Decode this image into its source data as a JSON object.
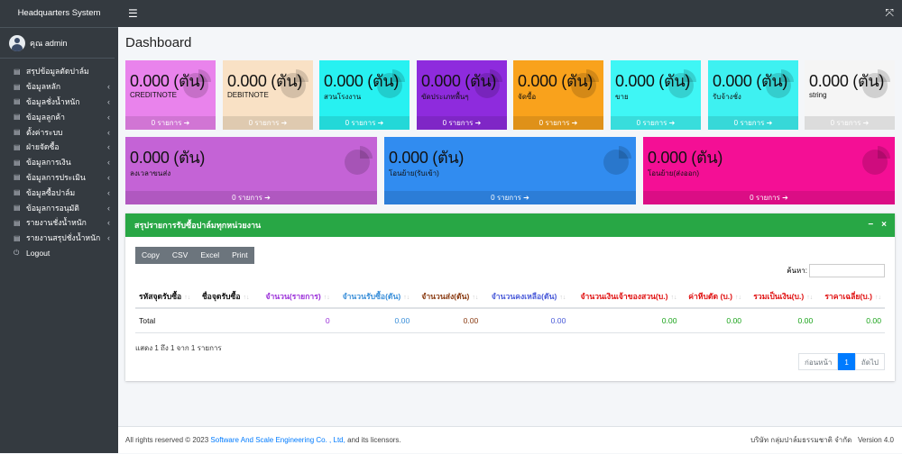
{
  "sidebar": {
    "brand": "Headquarters System",
    "user": "คุณ admin",
    "items": [
      {
        "label": "สรุปข้อมูลตัดปาล์ม",
        "chevron": ""
      },
      {
        "label": "ข้อมูลหลัก",
        "chevron": "‹"
      },
      {
        "label": "ข้อมูลชั่งน้ำหนัก",
        "chevron": "‹"
      },
      {
        "label": "ข้อมูลลูกค้า",
        "chevron": "‹"
      },
      {
        "label": "ตั้งค่าระบบ",
        "chevron": "‹"
      },
      {
        "label": "ฝ่ายจัดซื้อ",
        "chevron": "‹"
      },
      {
        "label": "ข้อมูลการเงิน",
        "chevron": "‹"
      },
      {
        "label": "ข้อมูลการประเมิน",
        "chevron": "‹"
      },
      {
        "label": "ข้อมูลซื้อปาล์ม",
        "chevron": "‹"
      },
      {
        "label": "ข้อมูลการอนุมัติ",
        "chevron": "‹"
      },
      {
        "label": "รายงานชั่งน้ำหนัก",
        "chevron": "‹"
      },
      {
        "label": "รายงานสรุปชั่งน้ำหนัก",
        "chevron": "‹"
      },
      {
        "label": "Logout",
        "chevron": ""
      }
    ]
  },
  "page": {
    "title": "Dashboard"
  },
  "stats_row1": [
    {
      "value": "0.000 (ตัน)",
      "label": "CREDITNOTE",
      "footer": "0 รายการ",
      "color": "#e983ec"
    },
    {
      "value": "0.000 (ตัน)",
      "label": "DEBITNOTE",
      "footer": "0 รายการ",
      "color": "#f9e1c5"
    },
    {
      "value": "0.000 (ตัน)",
      "label": "สวนโรงงาน",
      "footer": "0 รายการ",
      "color": "#27f1f1"
    },
    {
      "value": "0.000 (ตัน)",
      "label": "ขัดประเภทพื้นๆ",
      "footer": "0 รายการ",
      "color": "#8e2bdd"
    },
    {
      "value": "0.000 (ตัน)",
      "label": "จัดซื้อ",
      "footer": "0 รายการ",
      "color": "#f9a21c"
    },
    {
      "value": "0.000 (ตัน)",
      "label": "ขาย",
      "footer": "0 รายการ",
      "color": "#3ff6f5"
    },
    {
      "value": "0.000 (ตัน)",
      "label": "รับจ้างชั่ง",
      "footer": "0 รายการ",
      "color": "#3ef1f1"
    },
    {
      "value": "0.000 (ตัน)",
      "label": "string",
      "footer": "0 รายการ",
      "color": "#f5f5f5"
    }
  ],
  "stats_row2": [
    {
      "value": "0.000 (ตัน)",
      "label": "ลงเวลาขนส่ง",
      "footer": "0 รายการ",
      "color": "#c463d6"
    },
    {
      "value": "0.000 (ตัน)",
      "label": "โอนย้าย(รับเข้า)",
      "footer": "0 รายการ",
      "color": "#318cf0"
    },
    {
      "value": "0.000 (ตัน)",
      "label": "โอนย้าย(ส่งออก)",
      "footer": "0 รายการ",
      "color": "#f40f95"
    }
  ],
  "card": {
    "title": "สรุปรายการรับซื้อปาล์มทุกหน่วยงาน",
    "buttons": [
      "Copy",
      "CSV",
      "Excel",
      "Print"
    ],
    "search_label": "ค้นหา:",
    "columns": [
      {
        "label": "รหัสจุดรับซื้อ",
        "color": "#111"
      },
      {
        "label": "ชื่อจุดรับซื้อ",
        "color": "#111"
      },
      {
        "label": "จำนวน(รายการ)",
        "color": "#9b30d9"
      },
      {
        "label": "จำนวนรับซื้อ(ตัน)",
        "color": "#3a8fd9"
      },
      {
        "label": "จำนวนส่ง(ตัน)",
        "color": "#8a3b12"
      },
      {
        "label": "จำนวนคงเหลือ(ตัน)",
        "color": "#4a5bd9"
      },
      {
        "label": "จำนวนเงินเจ้าของสวน(บ.)",
        "color": "#e01010"
      },
      {
        "label": "ค่าหีบตัด (บ.)",
        "color": "#e01010"
      },
      {
        "label": "รวมเป็นเงิน(บ.)",
        "color": "#e01010"
      },
      {
        "label": "ราคาเฉลี่ย(บ.)",
        "color": "#e01010"
      }
    ],
    "total_row": [
      "Total",
      "",
      "0",
      "0.00",
      "0.00",
      "0.00",
      "0.00",
      "0.00",
      "0.00",
      "0.00"
    ],
    "total_colors": [
      "#111",
      "#111",
      "#9b30d9",
      "#3a8fd9",
      "#8a3b12",
      "#4a5bd9",
      "#1aa31a",
      "#1aa31a",
      "#1aa31a",
      "#1aa31a"
    ],
    "info": "แสดง 1 ถึง 1 จาก 1 รายการ",
    "pager": {
      "prev": "ก่อนหน้า",
      "page": "1",
      "next": "ถัดไป"
    }
  },
  "footer": {
    "left": "All rights reserved © 2023",
    "link": "Software And Scale Engineering Co. , Ltd,",
    "left2": " and its licensors.",
    "company": "บริษัท กลุ่มปาล์มธรรมชาติ จำกัด",
    "version": "Version 4.0"
  }
}
